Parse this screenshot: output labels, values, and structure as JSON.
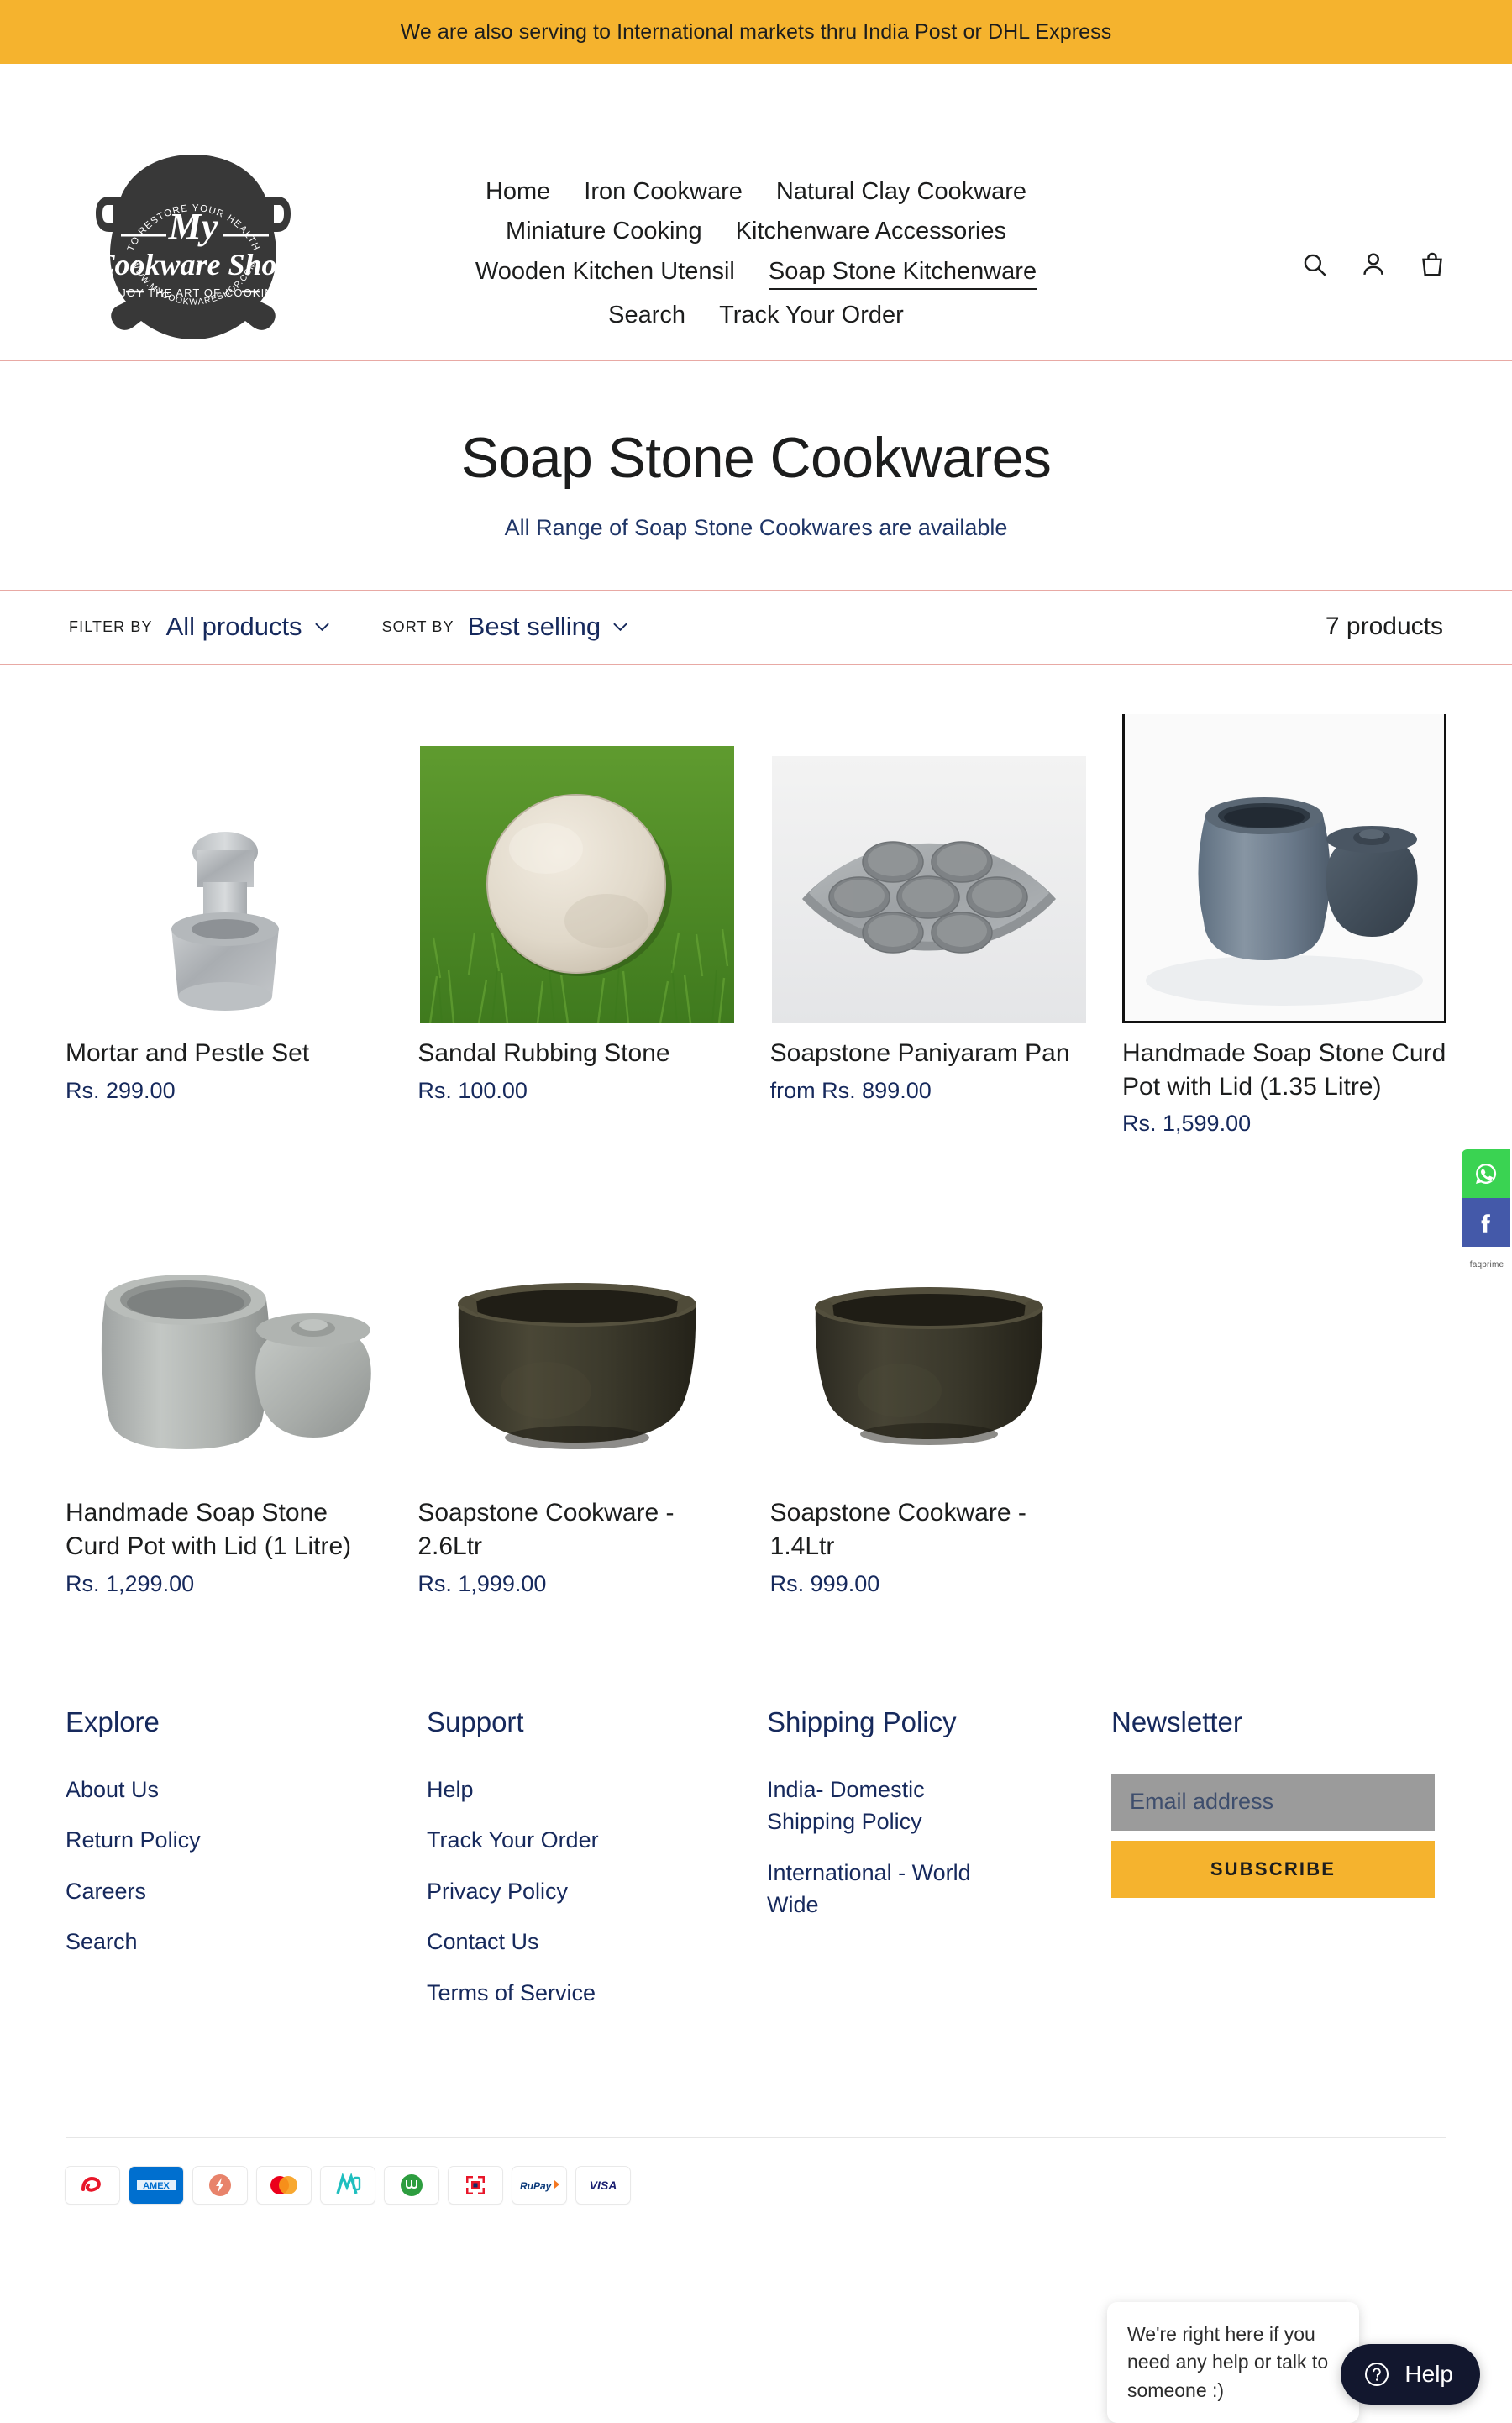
{
  "announcement": {
    "text": "We are also serving to International markets thru India Post or DHL Express",
    "bg_color": "#f5b32e"
  },
  "logo": {
    "top_arc": "TO RESTORE YOUR HEALTH",
    "line1": "My",
    "line2": "Cookware Shop",
    "tagline": "ENJOY THE ART OF COOKING",
    "url": "WWW.MYCOOKWARESHOP.COM"
  },
  "nav": {
    "rows": [
      [
        {
          "label": "Home",
          "active": false
        },
        {
          "label": "Iron Cookware",
          "active": false
        },
        {
          "label": "Natural Clay Cookware",
          "active": false
        }
      ],
      [
        {
          "label": "Miniature Cooking",
          "active": false
        },
        {
          "label": "Kitchenware Accessories",
          "active": false
        }
      ],
      [
        {
          "label": "Wooden Kitchen Utensil",
          "active": false
        },
        {
          "label": "Soap Stone Kitchenware",
          "active": true
        }
      ],
      [
        {
          "label": "Search",
          "active": false
        },
        {
          "label": "Track Your Order",
          "active": false
        }
      ]
    ],
    "icons": [
      "search-icon",
      "account-icon",
      "cart-icon"
    ]
  },
  "collection": {
    "title": "Soap Stone Cookwares",
    "description": "All Range of Soap Stone Cookwares are available",
    "accent_color": "#16295c",
    "rule_color": "#e8a9a4"
  },
  "toolbar": {
    "filter_label": "FILTER BY",
    "filter_value": "All products",
    "sort_label": "SORT BY",
    "sort_value": "Best selling",
    "product_count": "7 products"
  },
  "products": [
    {
      "title": "Mortar and Pestle Set",
      "price": "Rs. 299.00",
      "image": "mortar-pestle-set-image",
      "framed": false
    },
    {
      "title": "Sandal Rubbing Stone",
      "price": "Rs. 100.00",
      "image": "sandal-rubbing-stone-image",
      "framed": false
    },
    {
      "title": "Soapstone Paniyaram Pan",
      "price": "from Rs. 899.00",
      "image": "soapstone-paniyaram-pan-image",
      "framed": false
    },
    {
      "title": "Handmade Soap Stone Curd Pot with Lid (1.35 Litre)",
      "price": "Rs. 1,599.00",
      "image": "curd-pot-135-litre-image",
      "framed": true
    },
    {
      "title": "Handmade Soap Stone Curd Pot with Lid (1 Litre)",
      "price": "Rs. 1,299.00",
      "image": "curd-pot-1-litre-image",
      "framed": false
    },
    {
      "title": "Soapstone Cookware - 2.6Ltr",
      "price": "Rs. 1,999.00",
      "image": "soapstone-cookware-26ltr-image",
      "framed": false
    },
    {
      "title": "Soapstone Cookware - 1.4Ltr",
      "price": "Rs. 999.00",
      "image": "soapstone-cookware-14ltr-image",
      "framed": false
    }
  ],
  "footer": {
    "columns": [
      {
        "heading": "Explore",
        "links": [
          "About Us",
          "Return Policy",
          "Careers",
          "Search"
        ]
      },
      {
        "heading": "Support",
        "links": [
          "Help",
          "Track Your Order",
          "Privacy Policy",
          "Contact Us",
          "Terms of Service"
        ]
      },
      {
        "heading": "Shipping Policy",
        "links": [
          "India- Domestic Shipping Policy",
          "International - World Wide"
        ]
      }
    ],
    "newsletter": {
      "heading": "Newsletter",
      "placeholder": "Email address",
      "value": "",
      "button_label": "SUBSCRIBE",
      "button_color": "#f5b32e",
      "input_color": "#9b9b9b"
    },
    "payment_icons": [
      "airtel-money-icon",
      "amex-icon",
      "freecharge-icon",
      "mastercard-icon",
      "mobikwik-icon",
      "ola-money-icon",
      "paytm-icon",
      "rupay-icon",
      "visa-icon"
    ]
  },
  "share_rail": {
    "buttons": [
      "whatsapp-share-icon",
      "facebook-share-icon"
    ],
    "brand": "faqprime"
  },
  "help_widget": {
    "bubble_text": "We're right here if you need any help or talk to someone :)",
    "button_label": "Help",
    "button_color": "#12172e"
  }
}
